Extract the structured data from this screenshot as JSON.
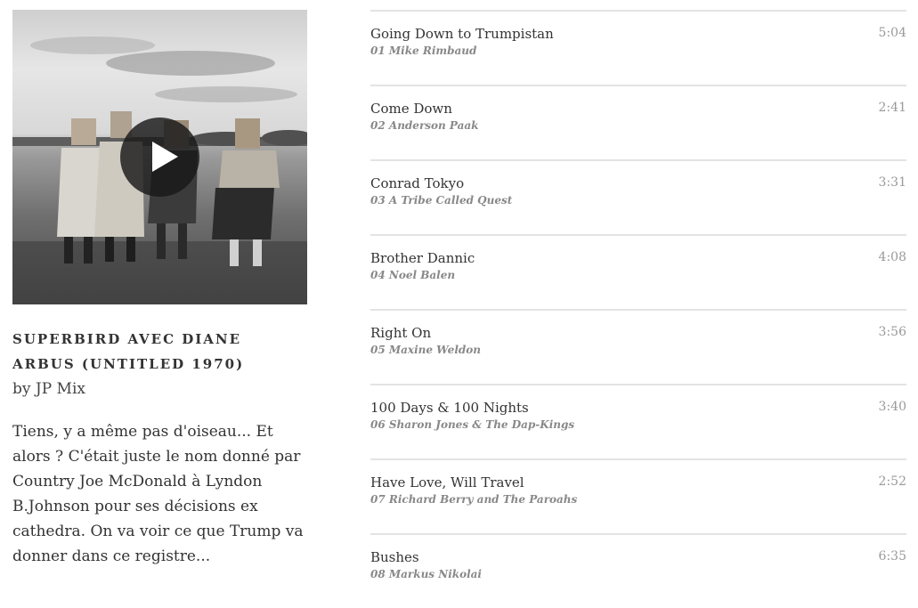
{
  "mix": {
    "title": "SUPERBIRD AVEC DIANE ARBUS (UNTITLED 1970)",
    "author": "by JP Mix",
    "description": "Tiens, y a même pas d'oiseau... Et alors ? C'était juste le nom donné par Country Joe McDonald à Lyndon B.Johnson pour ses décisions ex cathedra. On va voir ce que Trump va donner dans ce registre..."
  },
  "player": {
    "play_icon": "play-icon"
  },
  "tracks": [
    {
      "name": "Going Down to Trumpistan",
      "artist": "01 Mike Rimbaud",
      "duration": "5:04"
    },
    {
      "name": "Come Down",
      "artist": "02 Anderson Paak",
      "duration": "2:41"
    },
    {
      "name": "Conrad Tokyo",
      "artist": "03 A Tribe Called Quest",
      "duration": "3:31"
    },
    {
      "name": "Brother Dannic",
      "artist": "04 Noel Balen",
      "duration": "4:08"
    },
    {
      "name": "Right On",
      "artist": "05 Maxine Weldon",
      "duration": "3:56"
    },
    {
      "name": "100 Days & 100 Nights",
      "artist": "06 Sharon Jones & The Dap-Kings",
      "duration": "3:40"
    },
    {
      "name": "Have Love, Will Travel",
      "artist": "07 Richard Berry and The Paroahs",
      "duration": "2:52"
    },
    {
      "name": "Bushes",
      "artist": "08 Markus Nikolai",
      "duration": "6:35"
    }
  ]
}
